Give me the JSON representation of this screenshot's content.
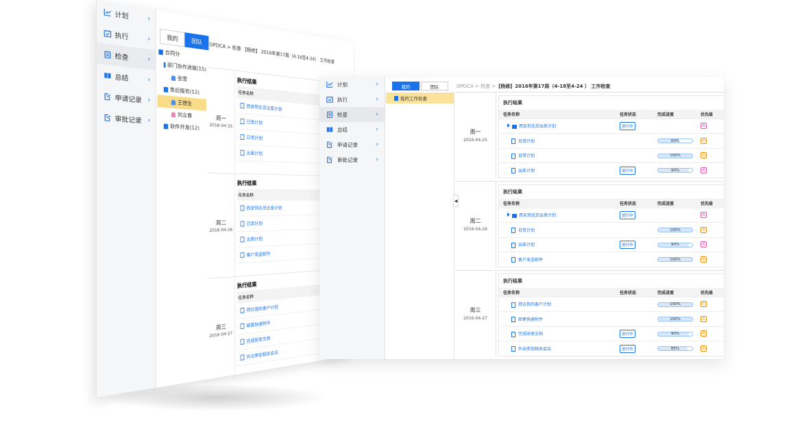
{
  "back": {
    "nav": [
      {
        "label": "计划",
        "icon": "chart-line-icon"
      },
      {
        "label": "执行",
        "icon": "calendar-check-icon"
      },
      {
        "label": "检查",
        "icon": "clipboard-icon",
        "active": true
      },
      {
        "label": "总结",
        "icon": "book-icon"
      },
      {
        "label": "申请记录",
        "icon": "edit-doc-icon"
      },
      {
        "label": "审批记录",
        "icon": "edit-doc-icon"
      }
    ],
    "toggle": {
      "mine": "我的",
      "team": "团队"
    },
    "breadcrumb": "OPDCA > 检查 【杨修】 2016年第17周（4-18至4-24） 工作检查",
    "tree": [
      {
        "label": "合同分",
        "type": "folder"
      },
      {
        "label": "部门协作进展(15)",
        "type": "folder"
      },
      {
        "label": "张雪",
        "type": "person"
      },
      {
        "label": "售后服务(12)",
        "type": "folder"
      },
      {
        "label": "王德生",
        "type": "person",
        "selected": true
      },
      {
        "label": "刘立春",
        "type": "person-pink"
      },
      {
        "label": "软件开发(12)",
        "type": "folder"
      }
    ],
    "days": [
      {
        "weekday": "周一",
        "date": "2016-04-25",
        "title": "执行结果",
        "header": "任务名称",
        "rows": [
          "西安到北京出差计划",
          "日常计划",
          "日常计划",
          "出差计划"
        ]
      },
      {
        "weekday": "周二",
        "date": "2016-04-26",
        "title": "执行结果",
        "header": "任务名称",
        "rows": [
          "西安到北京出差计划",
          "日常计划",
          "出差计划",
          "客户发送邮件"
        ]
      },
      {
        "weekday": "周三",
        "date": "2016-04-27",
        "title": "执行结果",
        "header": "任务名称",
        "rows": [
          "拜访我的客户计划",
          "邮寄快递附件",
          "完成研发文档",
          "外出参加相关会议"
        ]
      }
    ]
  },
  "front": {
    "nav": [
      {
        "label": "计划",
        "icon": "chart-line-icon"
      },
      {
        "label": "执行",
        "icon": "calendar-check-icon"
      },
      {
        "label": "检查",
        "icon": "clipboard-icon",
        "active": true
      },
      {
        "label": "总结",
        "icon": "book-icon"
      },
      {
        "label": "申请记录",
        "icon": "edit-doc-icon"
      },
      {
        "label": "审批记录",
        "icon": "edit-doc-icon"
      }
    ],
    "toggle": {
      "mine": "我的",
      "team": "团队"
    },
    "breadcrumb": {
      "path": "OPDCA > 检查 >",
      "user": "【杨修】",
      "title": "2016年第17周（4-18至4-24 ） 工作检查"
    },
    "tree_node": "我的工作检查",
    "columns": [
      "任务名称",
      "任务状态",
      "完成进度",
      "优先级"
    ],
    "accent": "#1a73e8",
    "days": [
      {
        "weekday": "周一",
        "date": "2016-04-25",
        "title": "执行结果",
        "rows": [
          {
            "name": "西安到北京出差计划",
            "kind": "folder",
            "status": "进行中",
            "progress": "",
            "priority": "高",
            "level": "high"
          },
          {
            "name": "日常计划",
            "kind": "doc",
            "status": "",
            "progress": "60%",
            "pct": 60,
            "priority": "中",
            "level": "mid"
          },
          {
            "name": "日常计划",
            "kind": "doc",
            "status": "",
            "progress": "100%",
            "pct": 100,
            "priority": "中",
            "level": "mid"
          },
          {
            "name": "出差计划",
            "kind": "doc",
            "status": "进行中",
            "progress": "90%",
            "pct": 90,
            "priority": "高",
            "level": "high"
          }
        ]
      },
      {
        "weekday": "周二",
        "date": "2016-04-26",
        "title": "执行结果",
        "rows": [
          {
            "name": "西安到北京出差计划",
            "kind": "folder",
            "status": "进行中",
            "progress": "",
            "priority": "高",
            "level": "high"
          },
          {
            "name": "日常计划",
            "kind": "doc",
            "status": "",
            "progress": "100%",
            "pct": 100,
            "priority": "中",
            "level": "mid"
          },
          {
            "name": "出差计划",
            "kind": "doc",
            "status": "进行中",
            "progress": "90%",
            "pct": 90,
            "priority": "高",
            "level": "high"
          },
          {
            "name": "客户发送邮件",
            "kind": "doc",
            "status": "",
            "progress": "100%",
            "pct": 100,
            "priority": "中",
            "level": "mid"
          }
        ]
      },
      {
        "weekday": "周三",
        "date": "2016-04-27",
        "title": "执行结果",
        "rows": [
          {
            "name": "拜访我的客户计划",
            "kind": "doc",
            "status": "",
            "progress": "100%",
            "pct": 100,
            "priority": "中",
            "level": "mid"
          },
          {
            "name": "邮寄快递附件",
            "kind": "doc",
            "status": "",
            "progress": "100%",
            "pct": 100,
            "priority": "中",
            "level": "mid"
          },
          {
            "name": "完成研发文档",
            "kind": "doc",
            "status": "进行中",
            "progress": "90%",
            "pct": 90,
            "priority": "中",
            "level": "mid"
          },
          {
            "name": "外出参加相关会议",
            "kind": "doc",
            "status": "进行中",
            "progress": "85%",
            "pct": 85,
            "priority": "中",
            "level": "mid"
          }
        ]
      }
    ]
  }
}
